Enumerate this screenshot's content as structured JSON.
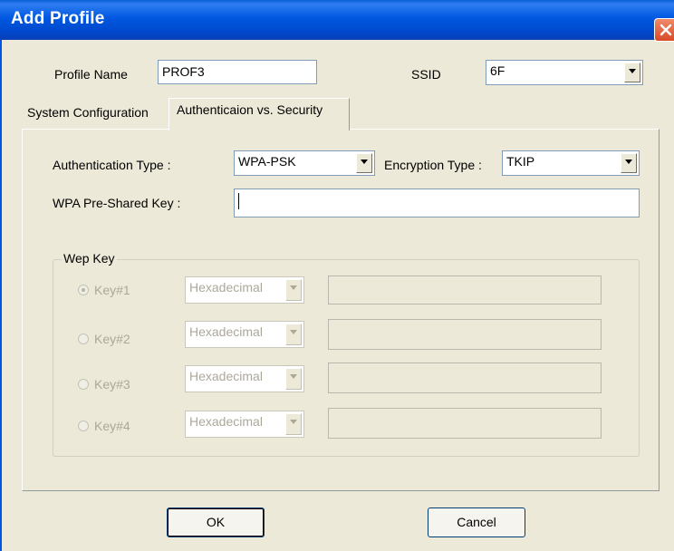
{
  "window": {
    "title": "Add Profile"
  },
  "profile": {
    "name_label": "Profile Name",
    "name_value": "PROF3"
  },
  "ssid": {
    "label": "SSID",
    "value": "6F"
  },
  "tabs": [
    {
      "label": "System Configuration"
    },
    {
      "label": "Authenticaion vs. Security"
    }
  ],
  "auth": {
    "type_label": "Authentication Type :",
    "type_value": "WPA-PSK",
    "enc_label": "Encryption Type :",
    "enc_value": "TKIP",
    "psk_label": "WPA Pre-Shared Key :",
    "psk_value": ""
  },
  "wep": {
    "group_label": "Wep Key",
    "keys": [
      {
        "label": "Key#1",
        "format": "Hexadecimal",
        "value": "",
        "selected": true
      },
      {
        "label": "Key#2",
        "format": "Hexadecimal",
        "value": "",
        "selected": false
      },
      {
        "label": "Key#3",
        "format": "Hexadecimal",
        "value": "",
        "selected": false
      },
      {
        "label": "Key#4",
        "format": "Hexadecimal",
        "value": "",
        "selected": false
      }
    ]
  },
  "buttons": {
    "ok": "OK",
    "cancel": "Cancel"
  }
}
